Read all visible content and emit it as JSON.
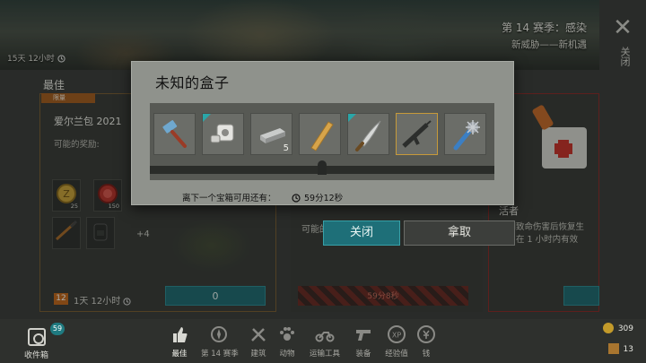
{
  "banner": {
    "timer": "15天 12小时",
    "season_title": "第 14 赛季：感染",
    "season_subtitle": "新威胁——新机遇"
  },
  "close": {
    "icon": "close-icon",
    "label": "关闭"
  },
  "left_card": {
    "section_label": "最佳",
    "badge": "限量",
    "title": "爱尔兰包 2021",
    "rewards_label": "可能的奖励:",
    "item_counts": [
      "25",
      "150"
    ],
    "more_label": "+4",
    "level_badge": "12",
    "time_left": "1天 12小时",
    "price": "0"
  },
  "mid_card": {
    "label": "可能的",
    "time_left": "59分8秒"
  },
  "right_card": {
    "title": "活者",
    "description": "受到致命伤害后恢复生命，在 1 小时内有效"
  },
  "modal": {
    "title": "未知的盒子",
    "items": [
      {
        "icon": "sledgehammer-icon",
        "rarity": "normal",
        "count": ""
      },
      {
        "icon": "mechanical-part-icon",
        "rarity": "teal",
        "count": ""
      },
      {
        "icon": "metal-bar-icon",
        "rarity": "normal",
        "count": "5"
      },
      {
        "icon": "wooden-plank-icon",
        "rarity": "normal",
        "count": ""
      },
      {
        "icon": "machete-icon",
        "rarity": "teal",
        "count": ""
      },
      {
        "icon": "assault-rifle-icon",
        "rarity": "gold",
        "count": ""
      },
      {
        "icon": "spiked-club-icon",
        "rarity": "normal",
        "count": ""
      }
    ],
    "next_box_label": "离下一个宝箱可用还有：",
    "next_box_time": "59分12秒",
    "close_button": "关闭",
    "take_button": "拿取"
  },
  "inbox": {
    "label": "收件箱",
    "count": "59"
  },
  "tabs": [
    {
      "label": "最佳",
      "icon": "thumbs-up-icon",
      "active": true
    },
    {
      "label": "第 14 赛季",
      "icon": "season-icon",
      "active": false
    },
    {
      "label": "建筑",
      "icon": "tools-icon",
      "active": false
    },
    {
      "label": "动物",
      "icon": "paw-icon",
      "active": false
    },
    {
      "label": "运输工具",
      "icon": "motorcycle-icon",
      "active": false
    },
    {
      "label": "装备",
      "icon": "pistol-icon",
      "active": false
    },
    {
      "label": "经验值",
      "icon": "xp-icon",
      "active": false
    },
    {
      "label": "钱",
      "icon": "money-icon",
      "active": false
    }
  ],
  "currency": {
    "coins": "309",
    "crates": "13"
  },
  "colors": {
    "accent": "#1e6f78",
    "limited": "#a45c1f",
    "danger": "#8a2a28"
  }
}
